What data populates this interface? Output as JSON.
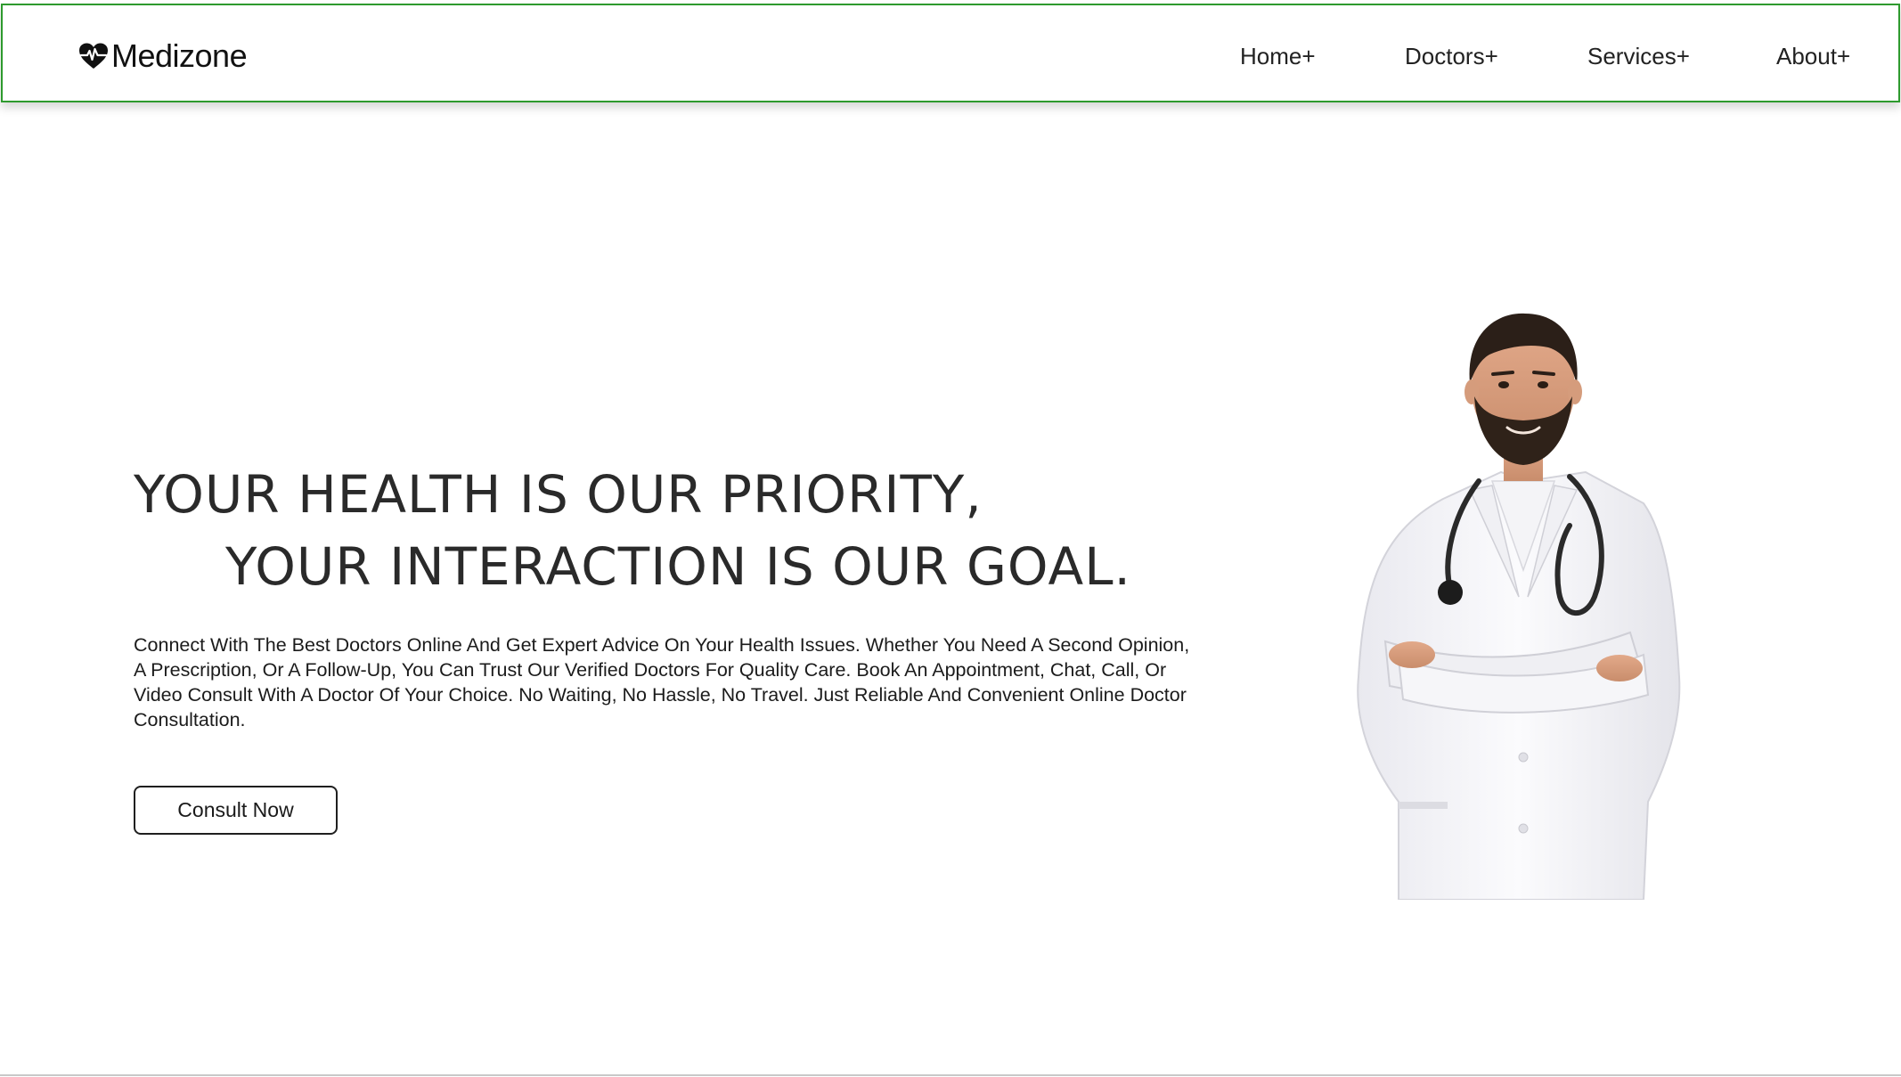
{
  "brand": {
    "name": "Medizone",
    "icon": "heart-pulse-icon",
    "color": "#111111"
  },
  "nav": {
    "border_color": "#2e9a2e",
    "items": [
      {
        "label": "Home+"
      },
      {
        "label": "Doctors+"
      },
      {
        "label": "Services+"
      },
      {
        "label": "About+"
      }
    ]
  },
  "hero": {
    "headline_line1": "YOUR HEALTH IS OUR PRIORITY,",
    "headline_line2": "YOUR INTERACTION IS OUR GOAL.",
    "description": "Connect With The Best Doctors Online And Get Expert Advice On Your Health Issues. Whether You Need A Second Opinion, A Prescription, Or A Follow-Up, You Can Trust Our Verified Doctors For Quality Care. Book An Appointment, Chat, Call, Or Video Consult With A Doctor Of Your Choice. No Waiting, No Hassle, No Travel. Just Reliable And Convenient Online Doctor Consultation.",
    "cta_label": "Consult Now",
    "image": "doctor-photo"
  }
}
